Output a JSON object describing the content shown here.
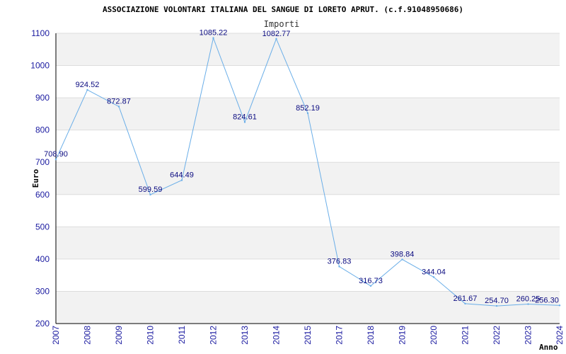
{
  "chart_data": {
    "type": "line",
    "title": "ASSOCIAZIONE VOLONTARI ITALIANA DEL SANGUE DI LORETO APRUT. (c.f.91048950686)",
    "subtitle": "Importi",
    "xlabel": "Anno",
    "ylabel": "Euro",
    "categories": [
      "2007",
      "2008",
      "2009",
      "2010",
      "2011",
      "2012",
      "2013",
      "2014",
      "2015",
      "2017",
      "2018",
      "2019",
      "2020",
      "2021",
      "2022",
      "2023",
      "2024"
    ],
    "series": [
      {
        "values": [
          708.9,
          924.52,
          872.87,
          599.59,
          644.49,
          1085.22,
          824.61,
          1082.77,
          852.19,
          376.83,
          316.73,
          398.84,
          344.04,
          261.67,
          254.7,
          260.25,
          256.3
        ]
      }
    ],
    "data_labels": [
      "708.90",
      "924.52",
      "872.87",
      "599.59",
      "644.49",
      "1085.22",
      "824.61",
      "1082.77",
      "852.19",
      "376.83",
      "316.73",
      "398.84",
      "344.04",
      "261.67",
      "254.70",
      "260.25",
      "256.30"
    ],
    "yticks": [
      "200",
      "300",
      "400",
      "500",
      "600",
      "700",
      "800",
      "900",
      "1000",
      "1100"
    ],
    "ylim": [
      200,
      1100
    ],
    "grid": true,
    "colors": {
      "line": "#6aaee8",
      "band": "#f2f2f2",
      "axis_text": "#1a1aa0",
      "label_text": "#0a0a80"
    }
  }
}
